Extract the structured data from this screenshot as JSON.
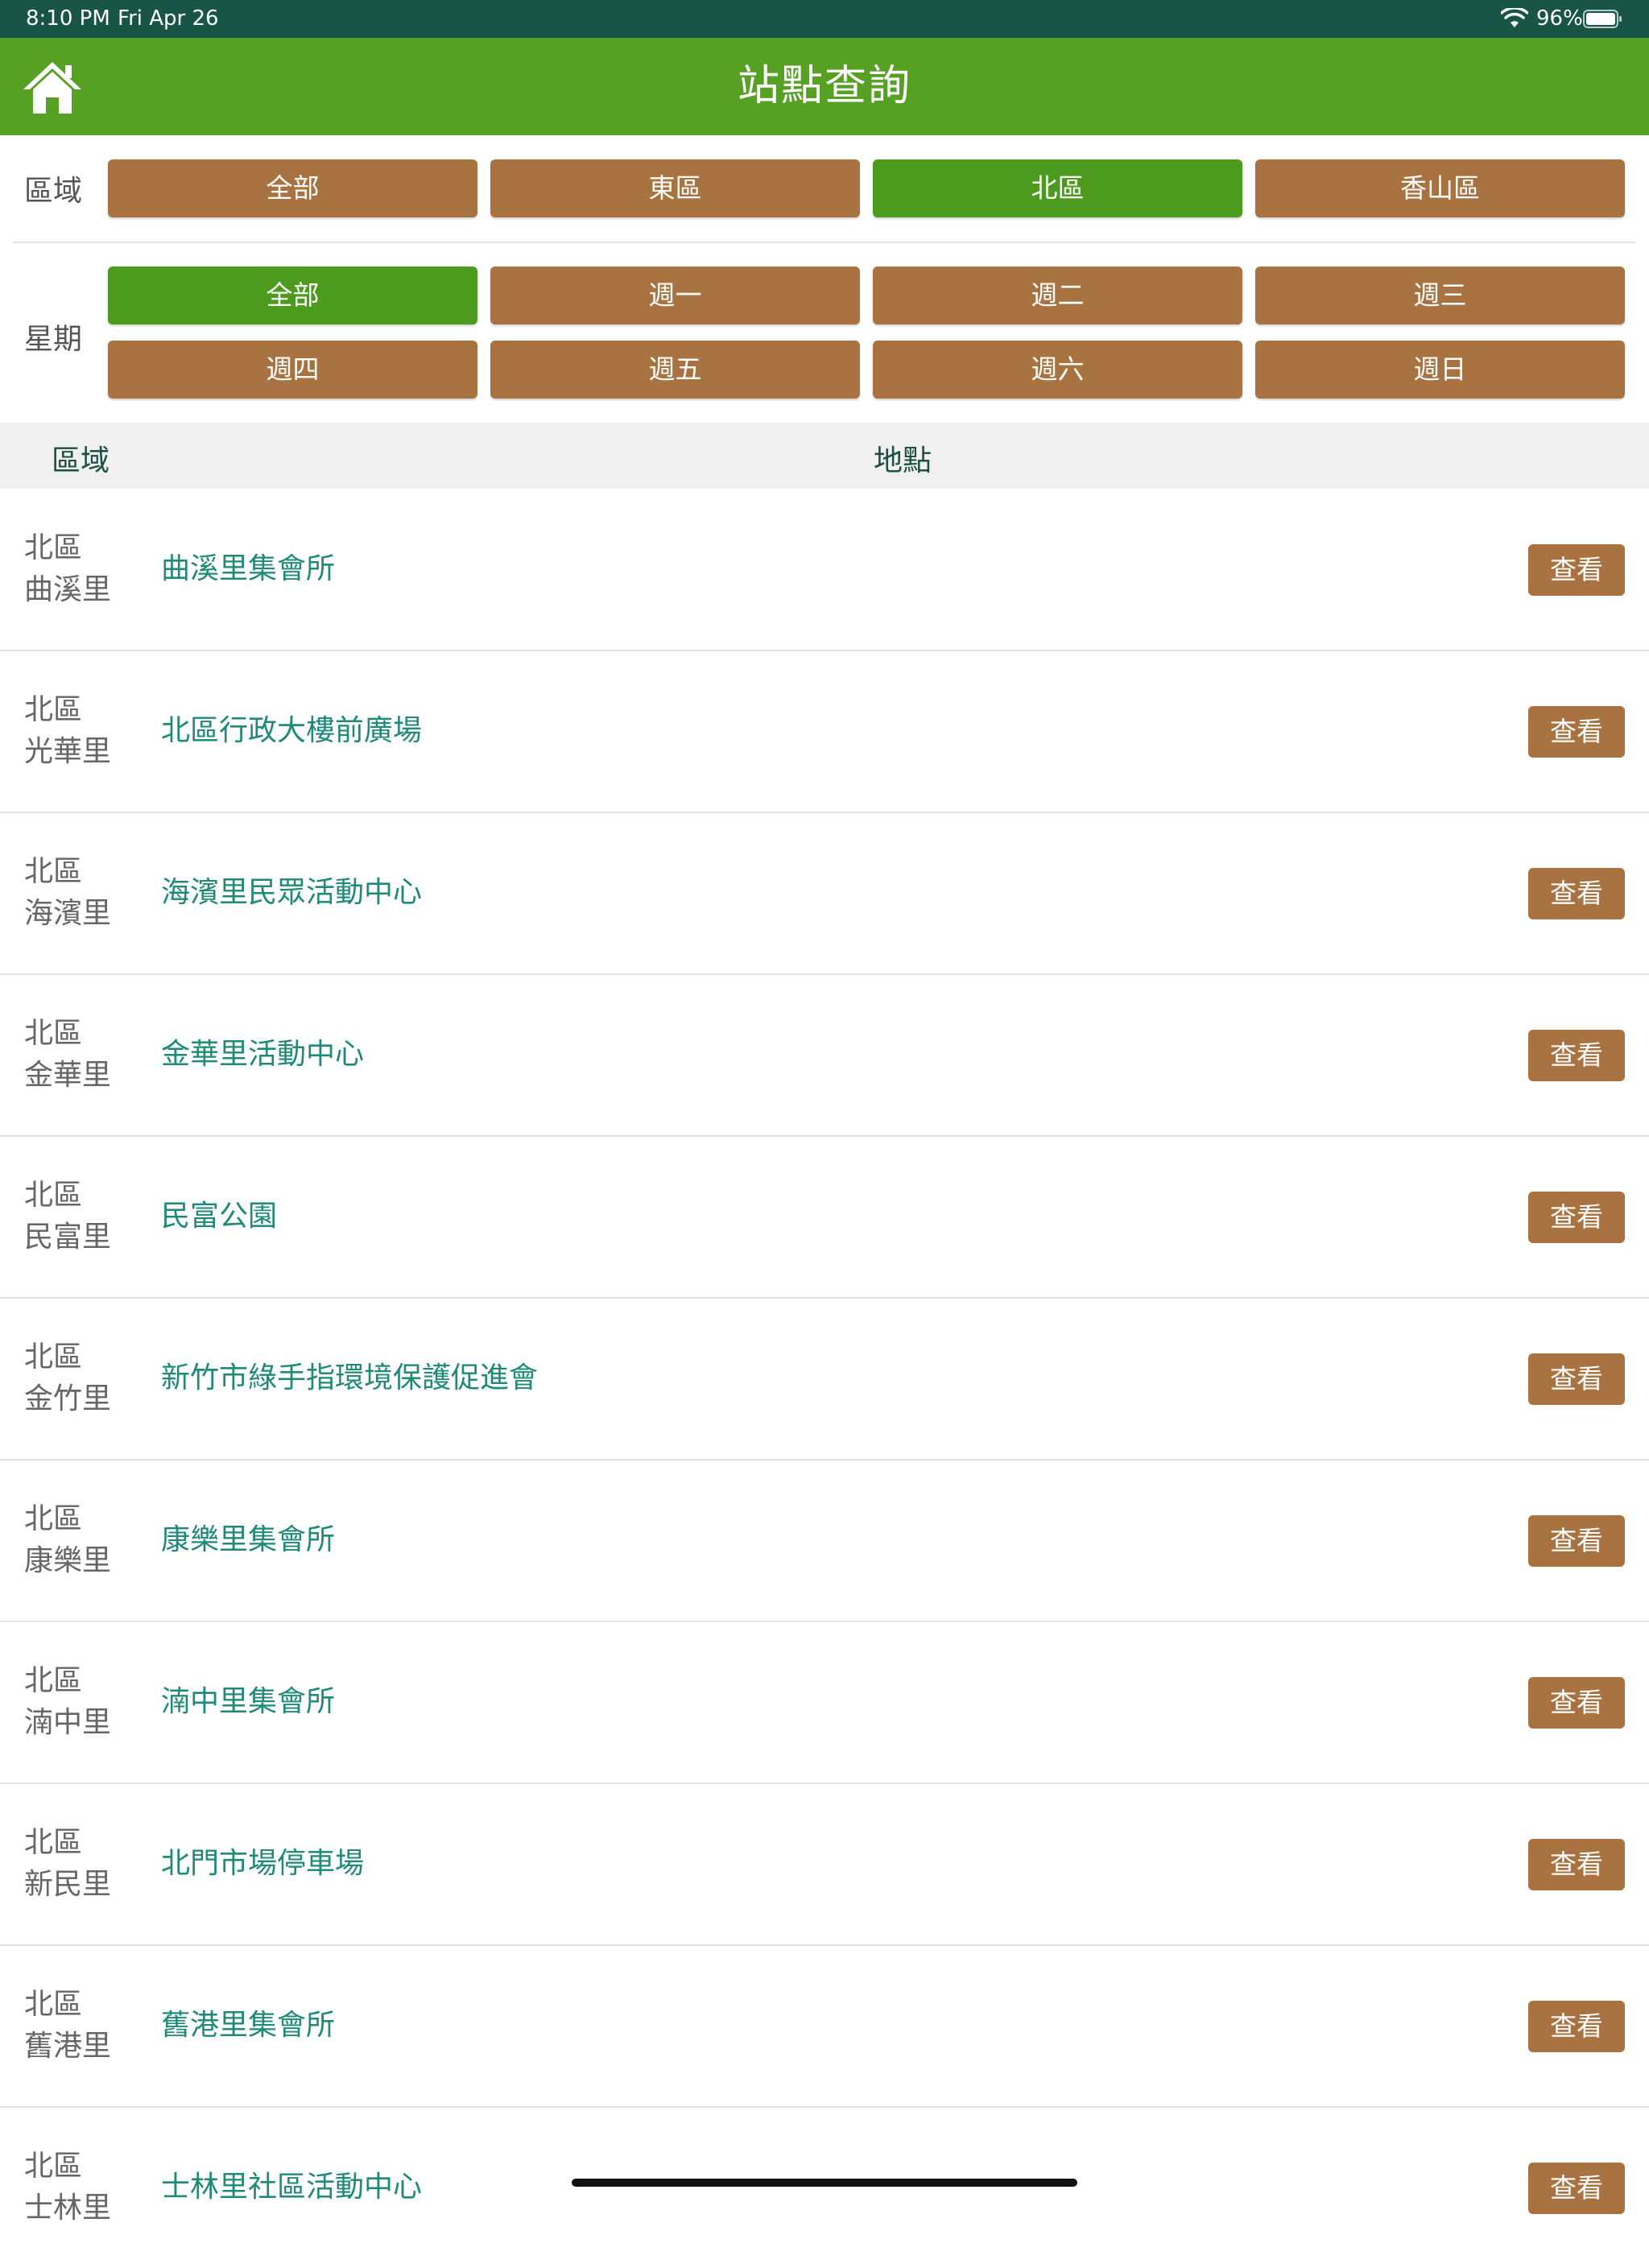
{
  "status_bar": {
    "time": "8:10 PM",
    "date": "Fri Apr 26",
    "battery": "96%"
  },
  "header": {
    "title": "站點查詢"
  },
  "filters": {
    "area_label": "區域",
    "areas": [
      "全部",
      "東區",
      "北區",
      "香山區"
    ],
    "selected_area": "北區",
    "weekday_label": "星期",
    "weekdays": [
      "全部",
      "週一",
      "週二",
      "週三",
      "週四",
      "週五",
      "週六",
      "週日"
    ],
    "selected_weekday": "全部"
  },
  "table": {
    "headers": {
      "area": "區域",
      "place": "地點"
    },
    "view_label": "查看",
    "rows": [
      {
        "district": "北區",
        "village": "曲溪里",
        "place": "曲溪里集會所"
      },
      {
        "district": "北區",
        "village": "光華里",
        "place": "北區行政大樓前廣場"
      },
      {
        "district": "北區",
        "village": "海濱里",
        "place": "海濱里民眾活動中心"
      },
      {
        "district": "北區",
        "village": "金華里",
        "place": "金華里活動中心"
      },
      {
        "district": "北區",
        "village": "民富里",
        "place": "民富公園"
      },
      {
        "district": "北區",
        "village": "金竹里",
        "place": "新竹市綠手指環境保護促進會"
      },
      {
        "district": "北區",
        "village": "康樂里",
        "place": "康樂里集會所"
      },
      {
        "district": "北區",
        "village": "湳中里",
        "place": "湳中里集會所"
      },
      {
        "district": "北區",
        "village": "新民里",
        "place": "北門市場停車場"
      },
      {
        "district": "北區",
        "village": "舊港里",
        "place": "舊港里集會所"
      },
      {
        "district": "北區",
        "village": "士林里",
        "place": "士林里社區活動中心"
      }
    ]
  },
  "colors": {
    "status_bar": "#185547",
    "nav_bar": "#56a023",
    "button_brown": "#a87341",
    "button_selected": "#4d9b1e",
    "place_text": "#1f8a78"
  },
  "icons": {
    "home": "home-icon",
    "wifi": "wifi-icon",
    "battery": "battery-icon"
  }
}
